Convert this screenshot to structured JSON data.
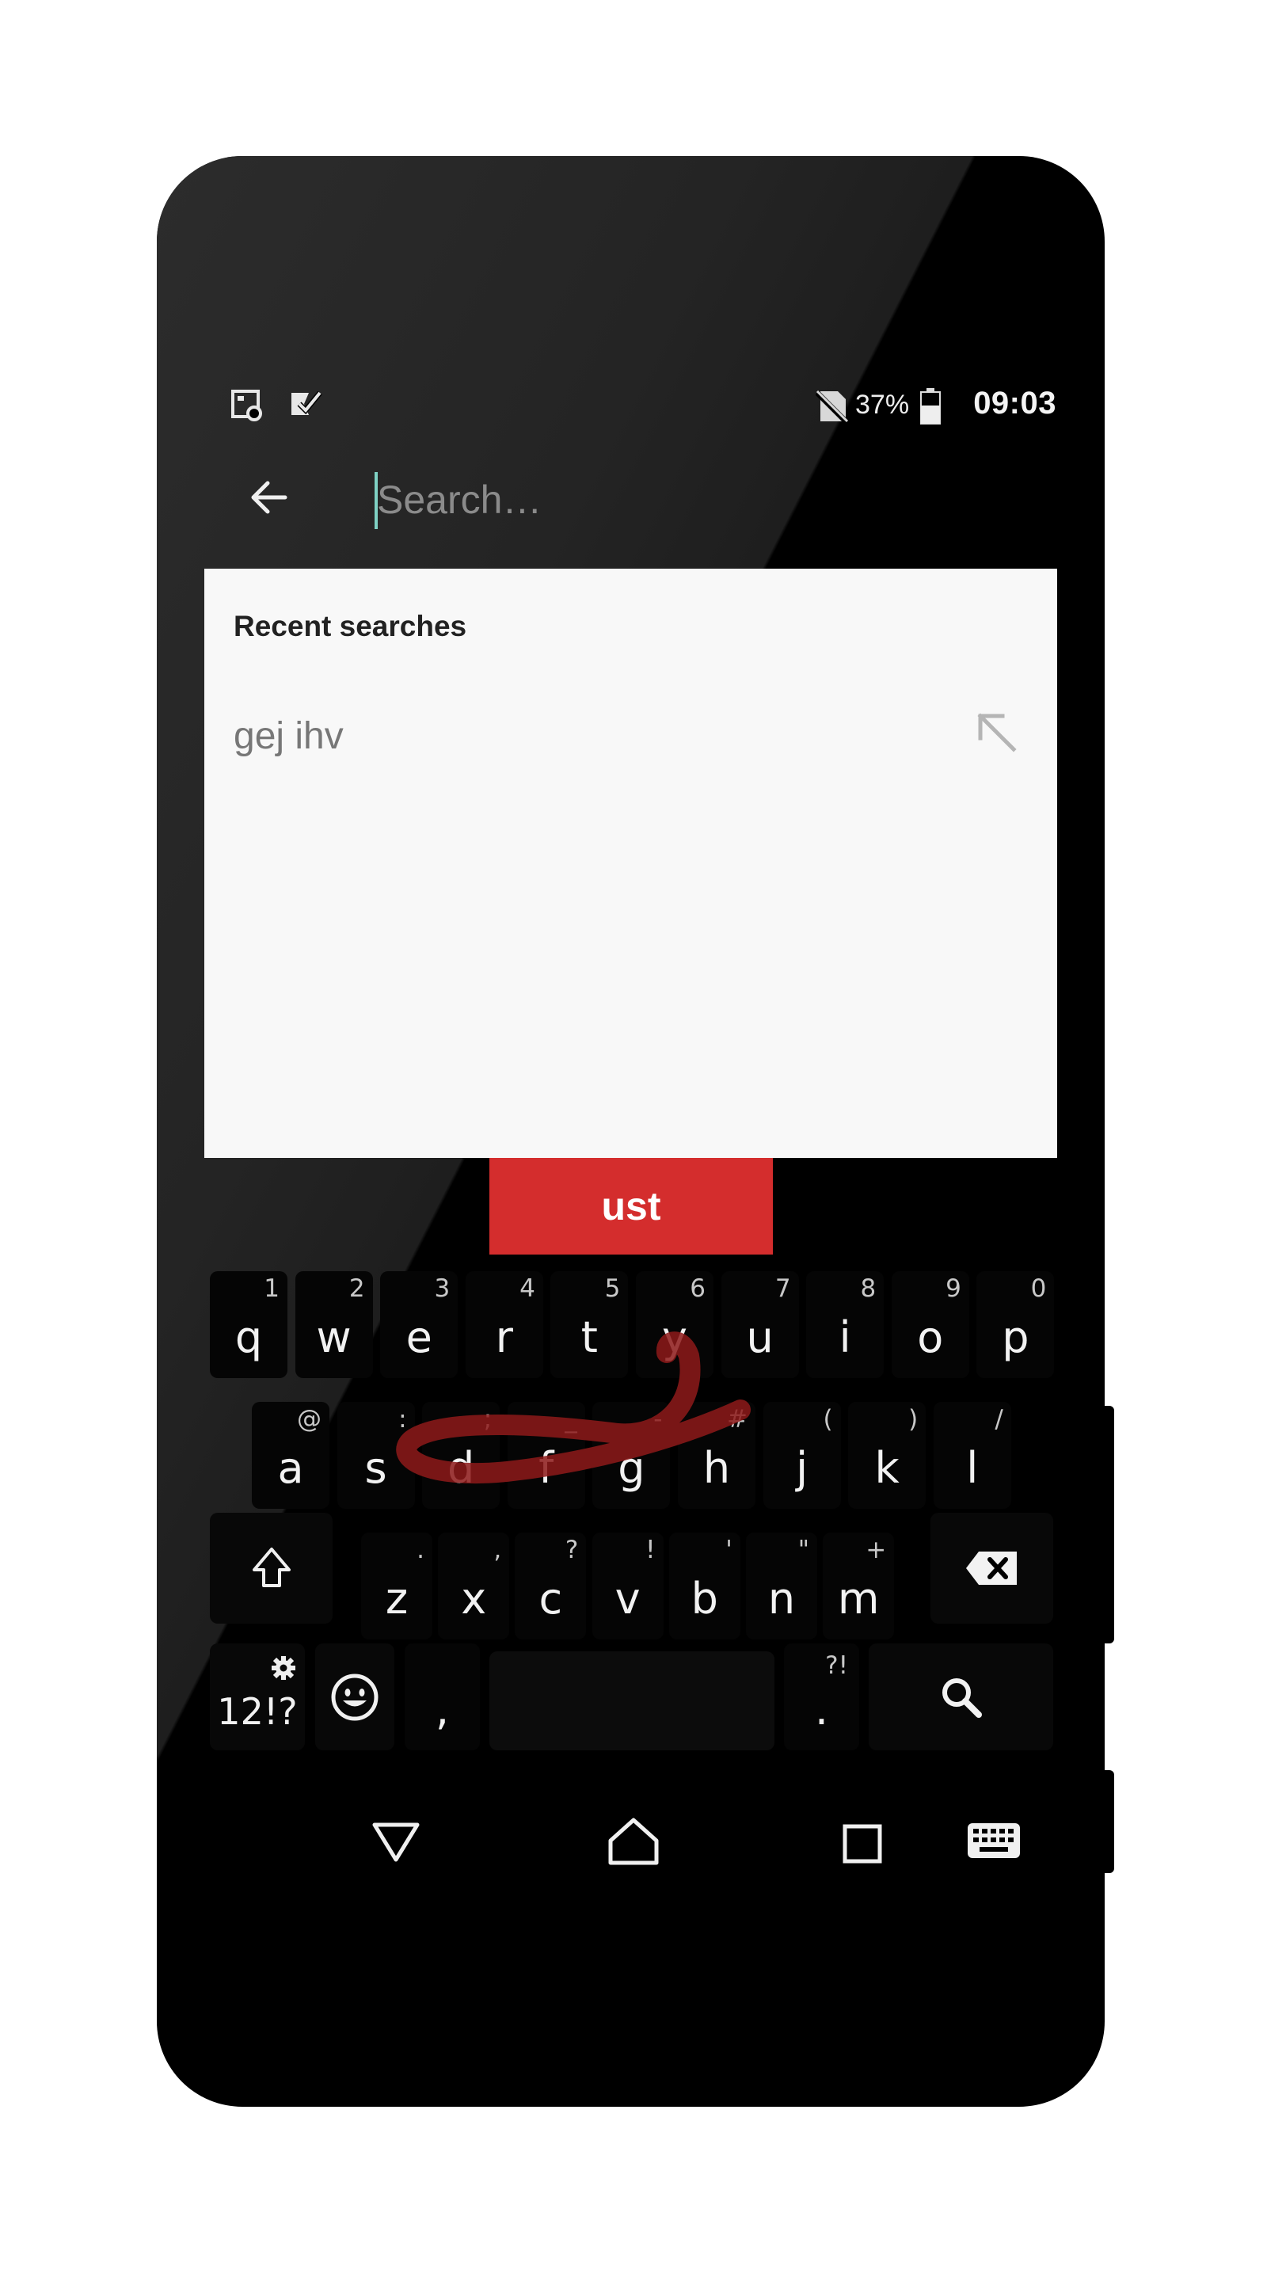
{
  "status_bar": {
    "battery_percent": "37%",
    "time": "09:03",
    "left_icons": [
      "screenshot-icon",
      "todo-check-icon"
    ],
    "right_icons": [
      "no-sim-icon",
      "battery-icon"
    ]
  },
  "app_bar": {
    "search_placeholder": "Search…",
    "search_value": ""
  },
  "recent": {
    "title": "Recent searches",
    "items": [
      {
        "label": "gej ihv"
      }
    ]
  },
  "suggestion": "ust",
  "keyboard": {
    "row1": [
      {
        "k": "q",
        "h": "1"
      },
      {
        "k": "w",
        "h": "2"
      },
      {
        "k": "e",
        "h": "3"
      },
      {
        "k": "r",
        "h": "4"
      },
      {
        "k": "t",
        "h": "5"
      },
      {
        "k": "y",
        "h": "6"
      },
      {
        "k": "u",
        "h": "7"
      },
      {
        "k": "i",
        "h": "8"
      },
      {
        "k": "o",
        "h": "9"
      },
      {
        "k": "p",
        "h": "0"
      }
    ],
    "row2": [
      {
        "k": "a",
        "h": "@"
      },
      {
        "k": "s",
        "h": ":"
      },
      {
        "k": "d",
        "h": ";"
      },
      {
        "k": "f",
        "h": "_"
      },
      {
        "k": "g",
        "h": "-"
      },
      {
        "k": "h",
        "h": "#"
      },
      {
        "k": "j",
        "h": "("
      },
      {
        "k": "k",
        "h": ")"
      },
      {
        "k": "l",
        "h": "/"
      }
    ],
    "row3": [
      {
        "k": "z",
        "h": "."
      },
      {
        "k": "x",
        "h": ","
      },
      {
        "k": "c",
        "h": "?"
      },
      {
        "k": "v",
        "h": "!"
      },
      {
        "k": "b",
        "h": "'"
      },
      {
        "k": "n",
        "h": "\""
      },
      {
        "k": "m",
        "h": "+"
      }
    ],
    "symbols_label": "12!?",
    "comma_label": ",",
    "period_label": ".",
    "period_hint": "?!",
    "accent_color": "#d42d2d",
    "swipe_trail_color": "#8e1a1a"
  },
  "nav_bar": {
    "buttons": [
      "back-icon",
      "home-icon",
      "recents-icon",
      "keyboard-icon"
    ]
  }
}
